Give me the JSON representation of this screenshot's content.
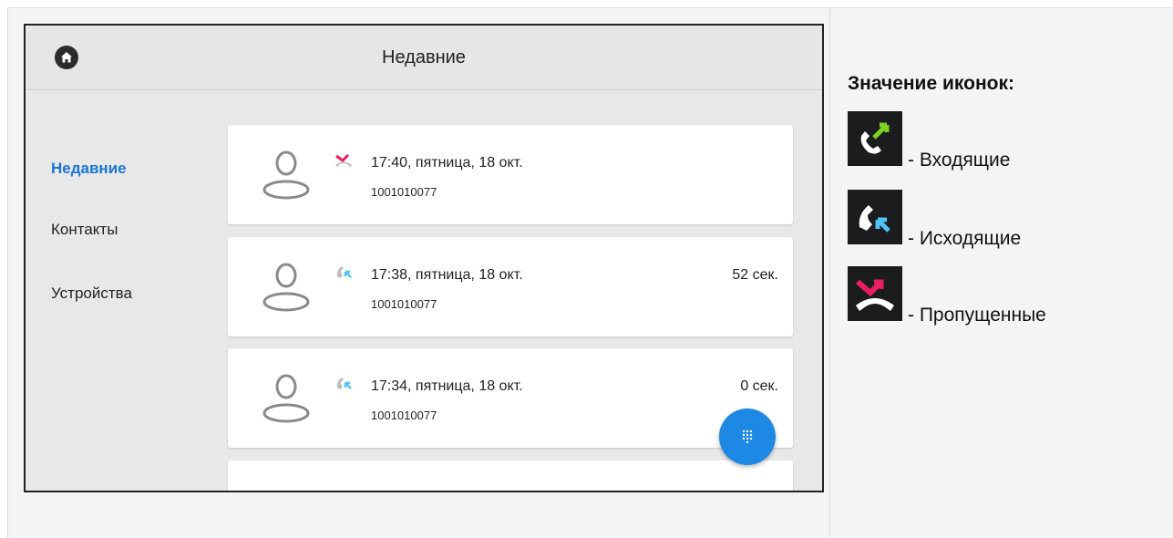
{
  "screen": {
    "title": "Недавние",
    "sidebar": {
      "items": [
        {
          "label": "Недавние",
          "active": true
        },
        {
          "label": "Контакты",
          "active": false
        },
        {
          "label": "Устройства",
          "active": false
        }
      ]
    },
    "calls": [
      {
        "type": "missed",
        "time": "17:40, пятница, 18 окт.",
        "number": "1001010077",
        "duration": ""
      },
      {
        "type": "outgoing",
        "time": "17:38, пятница, 18 окт.",
        "number": "1001010077",
        "duration": "52 сек."
      },
      {
        "type": "outgoing",
        "time": "17:34, пятница, 18 окт.",
        "number": "1001010077",
        "duration": "0 сек."
      }
    ],
    "icons": {
      "home": "home-icon",
      "avatar": "person-icon",
      "dialpad": "dialpad-icon"
    },
    "colors": {
      "accent": "#1976d2",
      "fab": "#1e88e5",
      "missed": "#e91e63",
      "outgoing": "#4fc3f7",
      "incoming": "#7cd322"
    }
  },
  "legend": {
    "title": "Значение иконок:",
    "items": [
      {
        "icon": "incoming-call-icon",
        "label": "- Входящие"
      },
      {
        "icon": "outgoing-call-icon",
        "label": "- Исходящие"
      },
      {
        "icon": "missed-call-icon",
        "label": "- Пропущенные"
      }
    ]
  }
}
